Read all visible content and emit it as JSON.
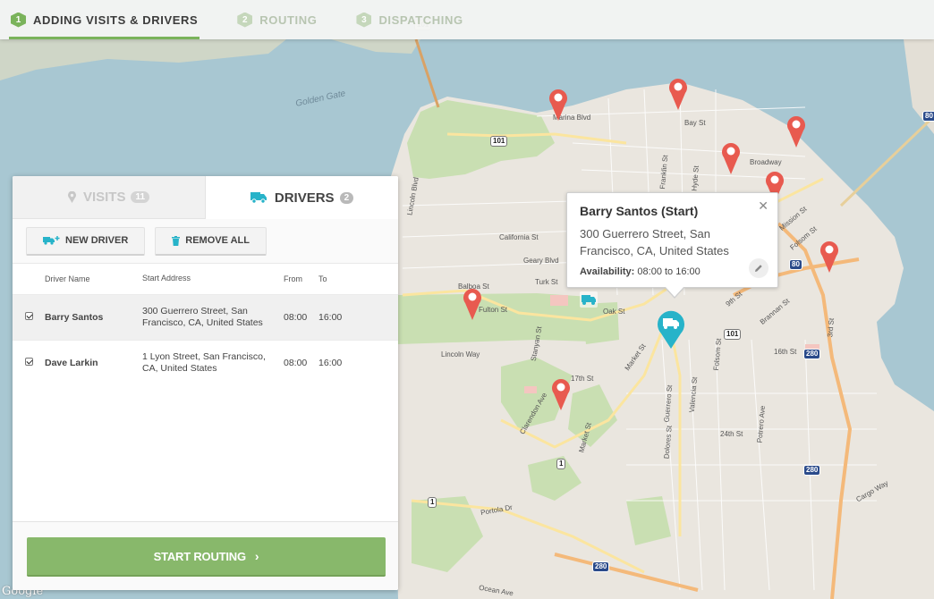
{
  "steps": [
    {
      "num": "1",
      "label": "ADDING VISITS & DRIVERS"
    },
    {
      "num": "2",
      "label": "ROUTING"
    },
    {
      "num": "3",
      "label": "DISPATCHING"
    }
  ],
  "tabs": {
    "visits": {
      "label": "VISITS",
      "count": "11"
    },
    "drivers": {
      "label": "DRIVERS",
      "count": "2"
    }
  },
  "toolbar": {
    "new_driver": "NEW DRIVER",
    "remove_all": "REMOVE ALL"
  },
  "table": {
    "headers": {
      "name": "Driver Name",
      "address": "Start Address",
      "from": "From",
      "to": "To"
    },
    "rows": [
      {
        "name": "Barry Santos",
        "address": "300 Guerrero Street, San Francisco, CA, United States",
        "from": "08:00",
        "to": "16:00"
      },
      {
        "name": "Dave Larkin",
        "address": "1 Lyon Street, San Francisco, CA, United States",
        "from": "08:00",
        "to": "16:00"
      }
    ]
  },
  "footer": {
    "start_routing": "START ROUTING"
  },
  "popup": {
    "title": "Barry Santos (Start)",
    "address": "300 Guerrero Street, San Francisco, CA, United States",
    "availability_label": "Availability:",
    "availability_value": "08:00 to 16:00"
  },
  "map": {
    "attribution": "Google",
    "labels": {
      "golden_gate": "Golden Gate",
      "marina": "Marina Blvd",
      "bay_st": "Bay St",
      "broadway": "Broadway",
      "california": "California St",
      "geary": "Geary Blvd",
      "turk": "Turk St",
      "fulton": "Fulton St",
      "oak": "Oak St",
      "lincoln": "Lincoln Way",
      "lincoln_blvd": "Lincoln Blvd",
      "franklin": "Franklin St",
      "hyde": "Hyde St",
      "market": "Market St",
      "market2": "Market St",
      "folsom": "Folsom St",
      "sixteenth": "16th St",
      "seventeenth": "17th St",
      "twentyfourth": "24th St",
      "guerrero": "Guerrero St",
      "valencia": "Valencia St",
      "dolores": "Dolores St",
      "potrero": "Potrero Ave",
      "brannan": "Brannan St",
      "third": "3rd St",
      "cargo": "Cargo Way",
      "portola": "Portola Dr",
      "clarendon": "Clarendon Ave",
      "stanyan": "Stanyan St",
      "ocean": "Ocean Ave",
      "mission": "Mission St",
      "folsom2": "Folsom St",
      "ninth": "9th St",
      "balboa": "Balboa St"
    },
    "shields": {
      "s101a": "101",
      "s101b": "101",
      "s101c": "101",
      "i80a": "80",
      "i80b": "80",
      "i280a": "280",
      "i280b": "280",
      "i280c": "280",
      "s1a": "1",
      "s1b": "1"
    },
    "colors": {
      "water": "#a8c7d2",
      "park": "#c9dfb2",
      "land": "#eae6df",
      "pin": "#e85a4f",
      "truck": "#27b3c9",
      "accent": "#7ab35b"
    }
  }
}
